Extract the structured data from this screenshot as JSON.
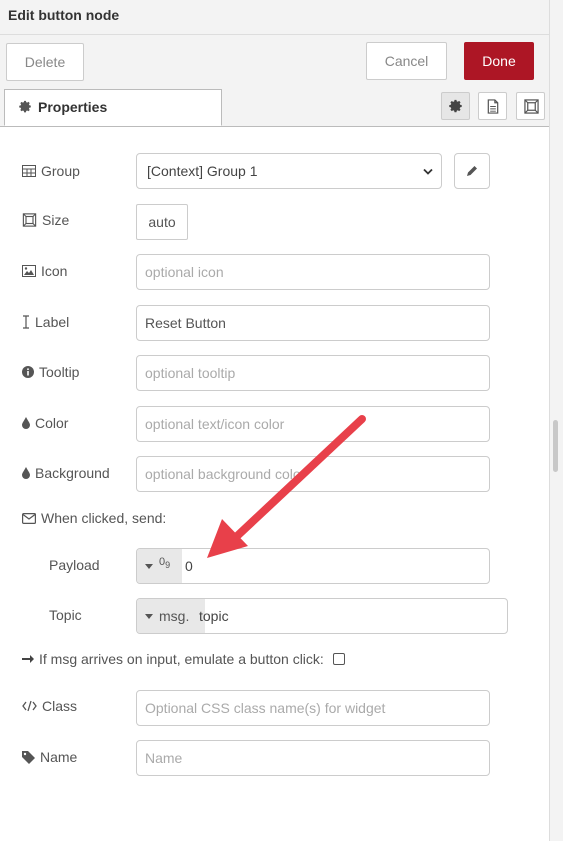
{
  "header": {
    "title": "Edit button node"
  },
  "toolbar": {
    "delete_label": "Delete",
    "cancel_label": "Cancel",
    "done_label": "Done",
    "done_color": "#ad1625"
  },
  "tabs": {
    "properties_label": "Properties",
    "icons": [
      "gear-icon",
      "description-icon",
      "appearance-icon"
    ]
  },
  "form": {
    "group": {
      "label": "Group",
      "value": "[Context] Group 1",
      "icon": "table-icon"
    },
    "size": {
      "label": "Size",
      "value": "auto",
      "icon": "size-icon"
    },
    "icon": {
      "label": "Icon",
      "placeholder": "optional icon",
      "icon": "image-icon"
    },
    "label": {
      "label": "Label",
      "value": "Reset Button",
      "icon": "text-cursor-icon"
    },
    "tooltip": {
      "label": "Tooltip",
      "placeholder": "optional tooltip",
      "icon": "info-icon"
    },
    "color": {
      "label": "Color",
      "placeholder": "optional text/icon color",
      "icon": "drop-icon"
    },
    "background": {
      "label": "Background",
      "placeholder": "optional background color",
      "icon": "drop-icon"
    },
    "when_clicked": {
      "label": "When clicked, send:",
      "icon": "envelope-icon"
    },
    "payload": {
      "label": "Payload",
      "type_label": "0",
      "type_sub": "9",
      "value": "0"
    },
    "topic": {
      "label": "Topic",
      "type_label": "msg.",
      "value": "topic"
    },
    "emulate": {
      "label": "If msg arrives on input, emulate a button click:",
      "checked": false,
      "icon": "arrow-right-icon"
    },
    "class": {
      "label": "Class",
      "placeholder": "Optional CSS class name(s) for widget",
      "icon": "code-icon"
    },
    "name": {
      "label": "Name",
      "placeholder": "Name",
      "icon": "tag-icon"
    }
  },
  "annotation": {
    "color": "#e8404a"
  }
}
